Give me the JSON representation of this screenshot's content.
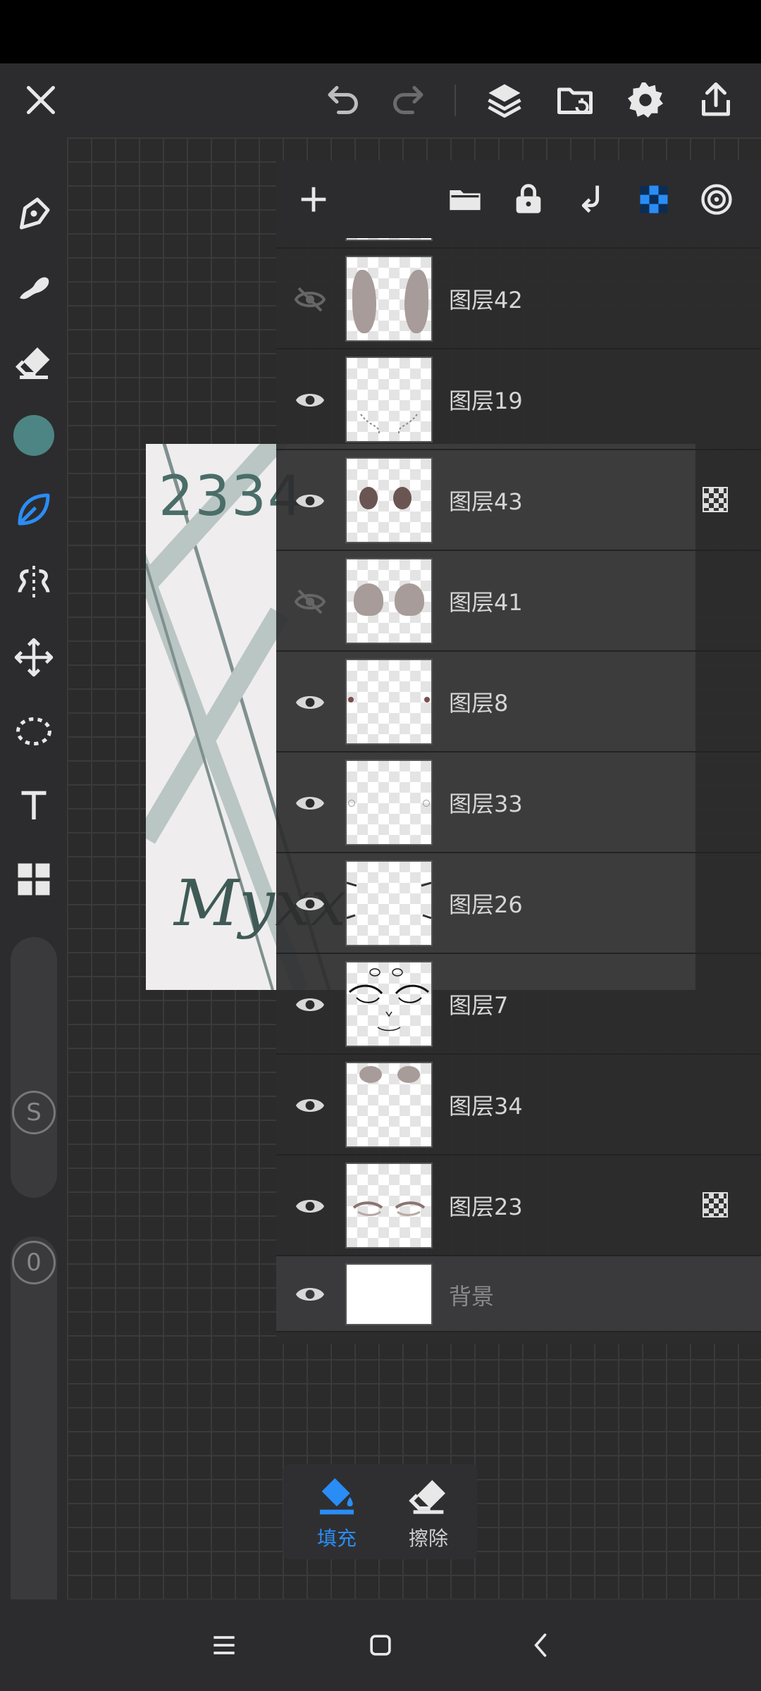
{
  "colors": {
    "accent": "#2a8df5",
    "current_color": "#4d8584",
    "toolbar_bg": "#2c2c2e",
    "icon": "#e8e8e8"
  },
  "top_bar": {
    "icons": [
      "close-icon",
      "undo-icon",
      "redo-icon",
      "layers-icon",
      "folder-import-icon",
      "settings-icon",
      "share-icon"
    ]
  },
  "tools": [
    "pen-icon",
    "smudge-icon",
    "eraser-icon",
    "color-swatch",
    "leaf-brush-icon",
    "symmetry-icon",
    "move-icon",
    "lasso-icon",
    "text-icon",
    "grid-icon"
  ],
  "sliders": {
    "size_value": "S",
    "opacity_value": "0"
  },
  "artwork": {
    "number_text": "2334",
    "signature_text": "Myxx"
  },
  "layer_toolbar": {
    "icons": [
      "add-layer-icon",
      "folder-icon",
      "lock-icon",
      "merge-down-icon",
      "alpha-lock-icon",
      "clipping-icon"
    ]
  },
  "layers": [
    {
      "name": "图层42",
      "visible": false,
      "alpha_lock": false
    },
    {
      "name": "图层19",
      "visible": true,
      "alpha_lock": false
    },
    {
      "name": "图层43",
      "visible": true,
      "alpha_lock": true
    },
    {
      "name": "图层41",
      "visible": false,
      "alpha_lock": false
    },
    {
      "name": "图层8",
      "visible": true,
      "alpha_lock": false
    },
    {
      "name": "图层33",
      "visible": true,
      "alpha_lock": false
    },
    {
      "name": "图层26",
      "visible": true,
      "alpha_lock": false
    },
    {
      "name": "图层7",
      "visible": true,
      "alpha_lock": false
    },
    {
      "name": "图层34",
      "visible": true,
      "alpha_lock": false
    },
    {
      "name": "图层23",
      "visible": true,
      "alpha_lock": true
    }
  ],
  "background_layer": {
    "name": "背景",
    "visible": true
  },
  "fill_erase": {
    "fill_label": "填充",
    "erase_label": "擦除"
  },
  "nav": [
    "menu-icon",
    "home-icon",
    "back-icon"
  ]
}
